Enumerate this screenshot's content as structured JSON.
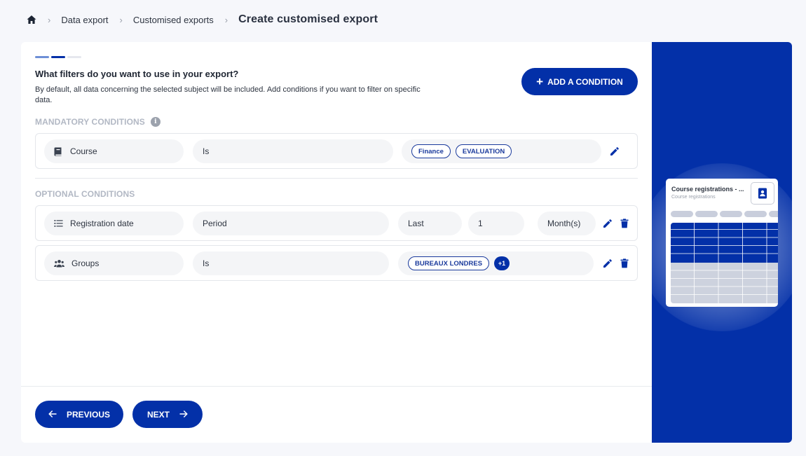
{
  "breadcrumb": {
    "items": [
      "Data export",
      "Customised exports"
    ],
    "current": "Create customised export"
  },
  "stepper": {
    "total_steps": 3,
    "current_step": 2,
    "colors": [
      "#6e8fd6",
      "#0330a8",
      "#e6e8ee"
    ]
  },
  "header": {
    "title": "What filters do you want to use in your export?",
    "description": "By default, all data concerning the selected subject will be included. Add conditions if you want to filter on specific data.",
    "add_button": "ADD A CONDITION"
  },
  "mandatory": {
    "title": "MANDATORY CONDITIONS",
    "rows": [
      {
        "field": "Course",
        "field_icon": "book-icon",
        "operator": "Is",
        "tags": [
          "Finance",
          "EVALUATION"
        ]
      }
    ]
  },
  "optional": {
    "title": "OPTIONAL CONDITIONS",
    "registration": {
      "field": "Registration date",
      "field_icon": "list-icon",
      "operator": "Period",
      "qualifier": "Last",
      "amount": "1",
      "unit": "Month(s)"
    },
    "groups": {
      "field": "Groups",
      "field_icon": "users-icon",
      "operator": "Is",
      "tags": [
        "BUREAUX LONDRES"
      ],
      "extra_count": "+1"
    }
  },
  "footer": {
    "previous": "PREVIOUS",
    "next": "NEXT"
  },
  "preview": {
    "title": "Course registrations - ...",
    "subtitle": "Course registrations",
    "badge_icon": "contact-book-icon"
  },
  "colors": {
    "primary": "#0330a8",
    "muted_text": "#b2b8c4",
    "pill_bg": "#f4f5f7",
    "page_bg": "#f6f7fb"
  }
}
